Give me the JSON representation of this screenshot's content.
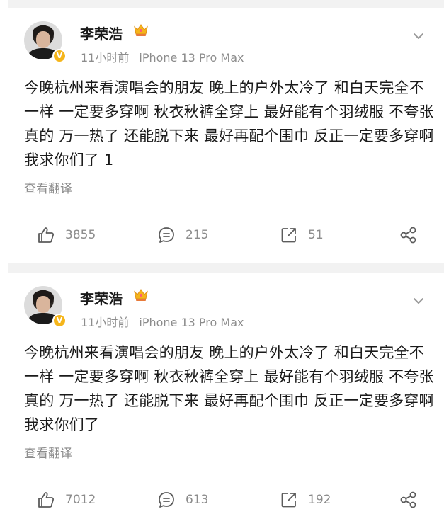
{
  "posts": [
    {
      "author": "李荣浩",
      "time": "11小时前",
      "device": "iPhone 13 Pro Max",
      "content": "今晚杭州来看演唱会的朋友  晚上的户外太冷了 和白天完全不一样 一定要多穿啊 秋衣秋裤全穿上 最好能有个羽绒服 不夸张 真的 万一热了 还能脱下来  最好再配个围巾 反正一定要多穿啊 我求你们了 1",
      "translate_label": "查看翻译",
      "likes": "3855",
      "comments": "215",
      "reposts": "51",
      "icons": {
        "like": "thumbs-up-icon",
        "comment": "comment-icon",
        "repost": "repost-icon",
        "share": "share-icon",
        "more": "chevron-down-icon",
        "badge": "verified-v-icon",
        "crown": "crown-icon"
      }
    },
    {
      "author": "李荣浩",
      "time": "11小时前",
      "device": "iPhone 13 Pro Max",
      "content": "今晚杭州来看演唱会的朋友  晚上的户外太冷了 和白天完全不一样 一定要多穿啊 秋衣秋裤全穿上 最好能有个羽绒服 不夸张 真的 万一热了 还能脱下来  最好再配个围巾 反正一定要多穿啊 我求你们了",
      "translate_label": "查看翻译",
      "likes": "7012",
      "comments": "613",
      "reposts": "192",
      "icons": {
        "like": "thumbs-up-icon",
        "comment": "comment-icon",
        "repost": "repost-icon",
        "share": "share-icon",
        "more": "chevron-down-icon",
        "badge": "verified-v-icon",
        "crown": "crown-icon"
      }
    }
  ],
  "colors": {
    "text": "#1a1a1a",
    "muted": "#8c8c8c",
    "badge": "#f5b51a",
    "separator": "#f2f2f2"
  }
}
